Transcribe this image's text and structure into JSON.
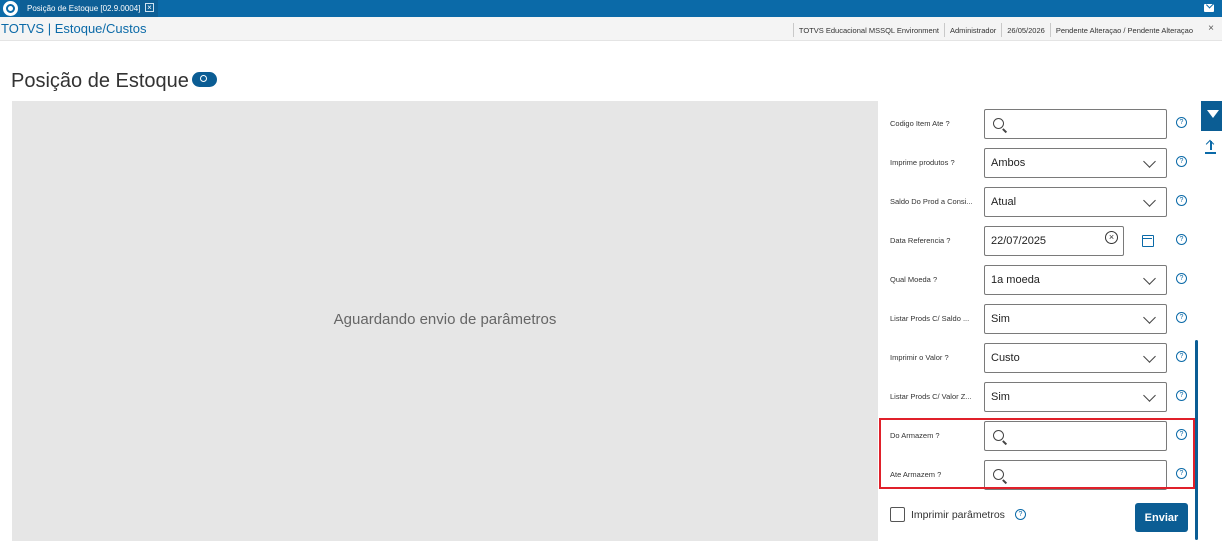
{
  "topbar": {
    "tab_title": "Posição de Estoque [02.9.0004]",
    "tab_close": "×"
  },
  "subbar": {
    "brand": "TOTVS | Estoque/Custos",
    "environment": "TOTVS Educacional MSSQL Environment",
    "user": "Administrador",
    "date": "26/05/2026",
    "status": "Pendente Alteraçao / Pendente Alteraçao",
    "close": "×"
  },
  "page": {
    "title": "Posição de Estoque"
  },
  "preview": {
    "message": "Aguardando envio de parâmetros"
  },
  "params": [
    {
      "label": "Codigo Item Ate ?",
      "value": "",
      "type": "search"
    },
    {
      "label": "Imprime produtos ?",
      "value": "Ambos",
      "type": "select"
    },
    {
      "label": "Saldo Do Prod a Consi...",
      "value": "Atual",
      "type": "select"
    },
    {
      "label": "Data Referencia ?",
      "value": "22/07/2025",
      "type": "date"
    },
    {
      "label": "Qual Moeda ?",
      "value": "1a moeda",
      "type": "select"
    },
    {
      "label": "Listar Prods C/ Saldo ...",
      "value": "Sim",
      "type": "select"
    },
    {
      "label": "Imprimir o Valor ?",
      "value": "Custo",
      "type": "select"
    },
    {
      "label": "Listar Prods C/ Valor Z...",
      "value": "Sim",
      "type": "select"
    },
    {
      "label": "Do Armazem ?",
      "value": "",
      "type": "search"
    },
    {
      "label": "Ate Armazem ?",
      "value": "",
      "type": "search"
    }
  ],
  "footer": {
    "print_params_label": "Imprimir parâmetros",
    "send_label": "Enviar"
  },
  "help_glyph": "?",
  "clear_glyph": "×",
  "colors": {
    "brand_blue": "#0b6aa8",
    "button_blue": "#0b5d94",
    "highlight_red": "#e0202a"
  }
}
